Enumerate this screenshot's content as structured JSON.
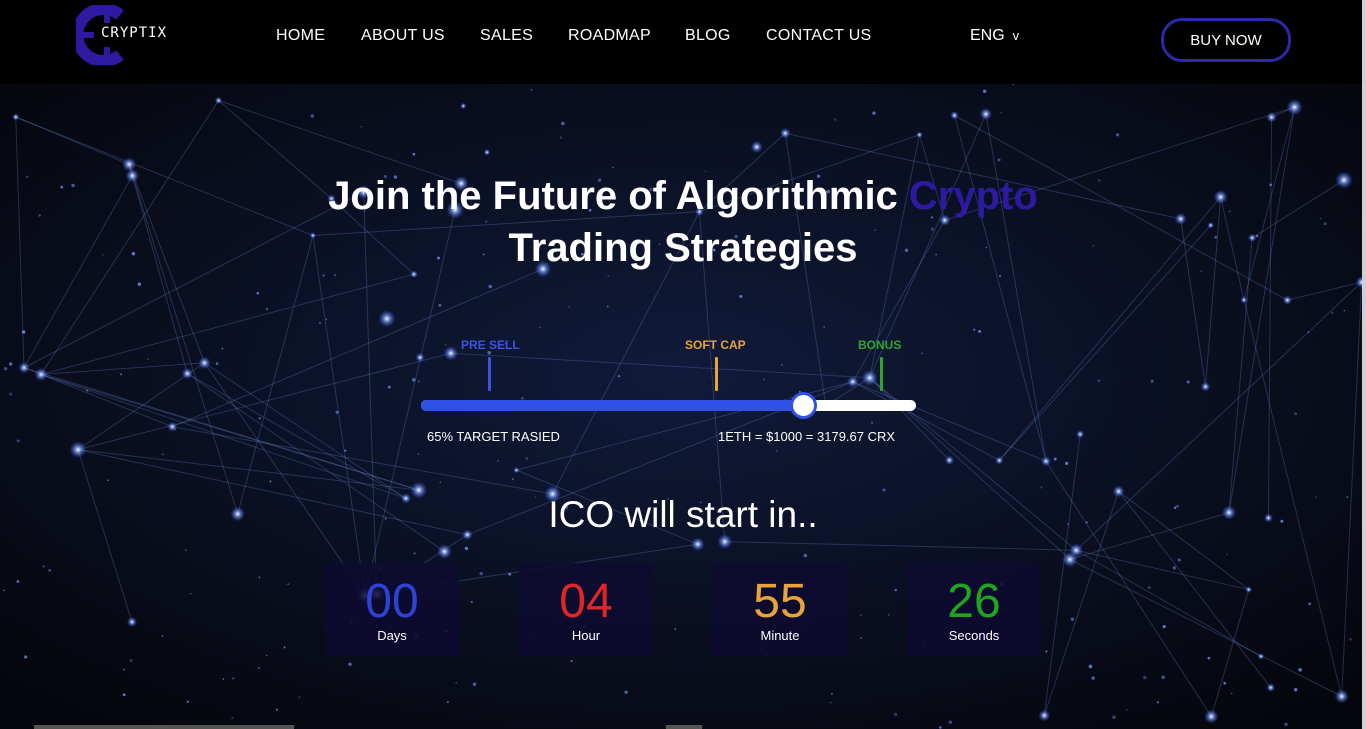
{
  "colors": {
    "accent": "#2e1aa0",
    "button_border": "#2d2aa6",
    "presell": "#3a55e0",
    "softcap": "#e8a33a",
    "bonus": "#2fa52f",
    "progress": "#3050e6"
  },
  "header": {
    "logo_text": "CRYPTIX",
    "nav": [
      "HOME",
      "ABOUT US",
      "SALES",
      "ROADMAP",
      "BLOG",
      "CONTACT US"
    ],
    "language": "ENG",
    "buy_label": "BUY NOW"
  },
  "hero": {
    "title_part1": "Join the Future of Algorithmic ",
    "title_accent": "Crypto",
    "title_line2": "Trading Strategies"
  },
  "progress": {
    "milestones": [
      "PRE SELL",
      "SOFT CAP",
      "BONUS"
    ],
    "fill_fraction": 0.77,
    "target_text": "65% TARGET RASIED",
    "rate_text": "1ETH = $1000 = 3179.67 CRX"
  },
  "countdown": {
    "heading": "ICO will start in..",
    "items": [
      {
        "value": "00",
        "unit": "Days",
        "color": "#2d43d8"
      },
      {
        "value": "04",
        "unit": "Hour",
        "color": "#e02626"
      },
      {
        "value": "55",
        "unit": "Minute",
        "color": "#e8a33a"
      },
      {
        "value": "26",
        "unit": "Seconds",
        "color": "#1ea51e"
      }
    ]
  }
}
